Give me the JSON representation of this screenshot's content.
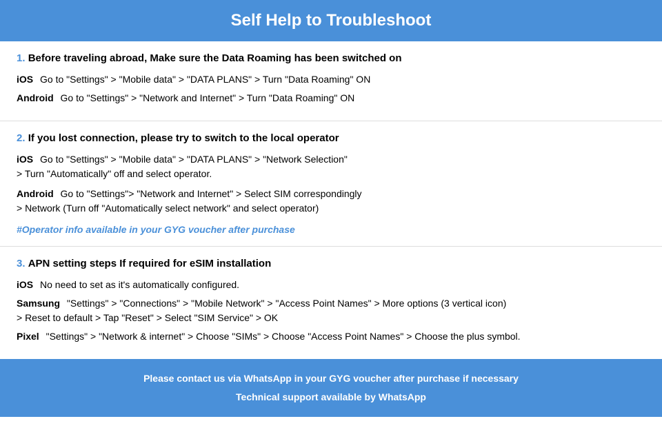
{
  "header": {
    "title": "Self Help to Troubleshoot"
  },
  "sections": [
    {
      "number": "1.",
      "title": "Before traveling abroad, Make sure the Data Roaming has been switched on",
      "rows": [
        {
          "platform": "iOS",
          "text": "Go to \"Settings\" > \"Mobile data\" > \"DATA PLANS\" > Turn \"Data Roaming\" ON"
        },
        {
          "platform": "Android",
          "text": "Go to \"Settings\" > \"Network and Internet\" > Turn \"Data Roaming\" ON"
        }
      ],
      "highlight": null
    },
    {
      "number": "2.",
      "title": "If you lost connection, please try to switch to the local operator",
      "rows": [
        {
          "platform": "iOS",
          "text": "Go to \"Settings\" > \"Mobile data\" > \"DATA PLANS\" > \"Network Selection\"\n> Turn \"Automatically\" off and select operator."
        },
        {
          "platform": "Android",
          "text": "Go to \"Settings\">  \"Network and Internet\" > Select SIM correspondingly\n> Network (Turn off \"Automatically select network\" and select operator)"
        }
      ],
      "highlight": "#Operator info available in your GYG voucher after purchase"
    },
    {
      "number": "3.",
      "title": "APN setting steps If required for eSIM installation",
      "rows": [
        {
          "platform": "iOS",
          "text": "No need to set as it's automatically configured."
        },
        {
          "platform": "Samsung",
          "text": "\"Settings\" > \"Connections\" > \"Mobile Network\" > \"Access Point Names\" > More options (3 vertical icon)\n> Reset to default > Tap \"Reset\" > Select \"SIM Service\" > OK"
        },
        {
          "platform": "Pixel",
          "text": "\"Settings\" > \"Network & internet\" > Choose \"SIMs\" > Choose \"Access Point Names\" > Choose the plus symbol."
        }
      ],
      "highlight": null
    }
  ],
  "footer": {
    "line1": "Please contact us via WhatsApp  in your GYG voucher after purchase if necessary",
    "line2": "Technical support available by WhatsApp"
  }
}
